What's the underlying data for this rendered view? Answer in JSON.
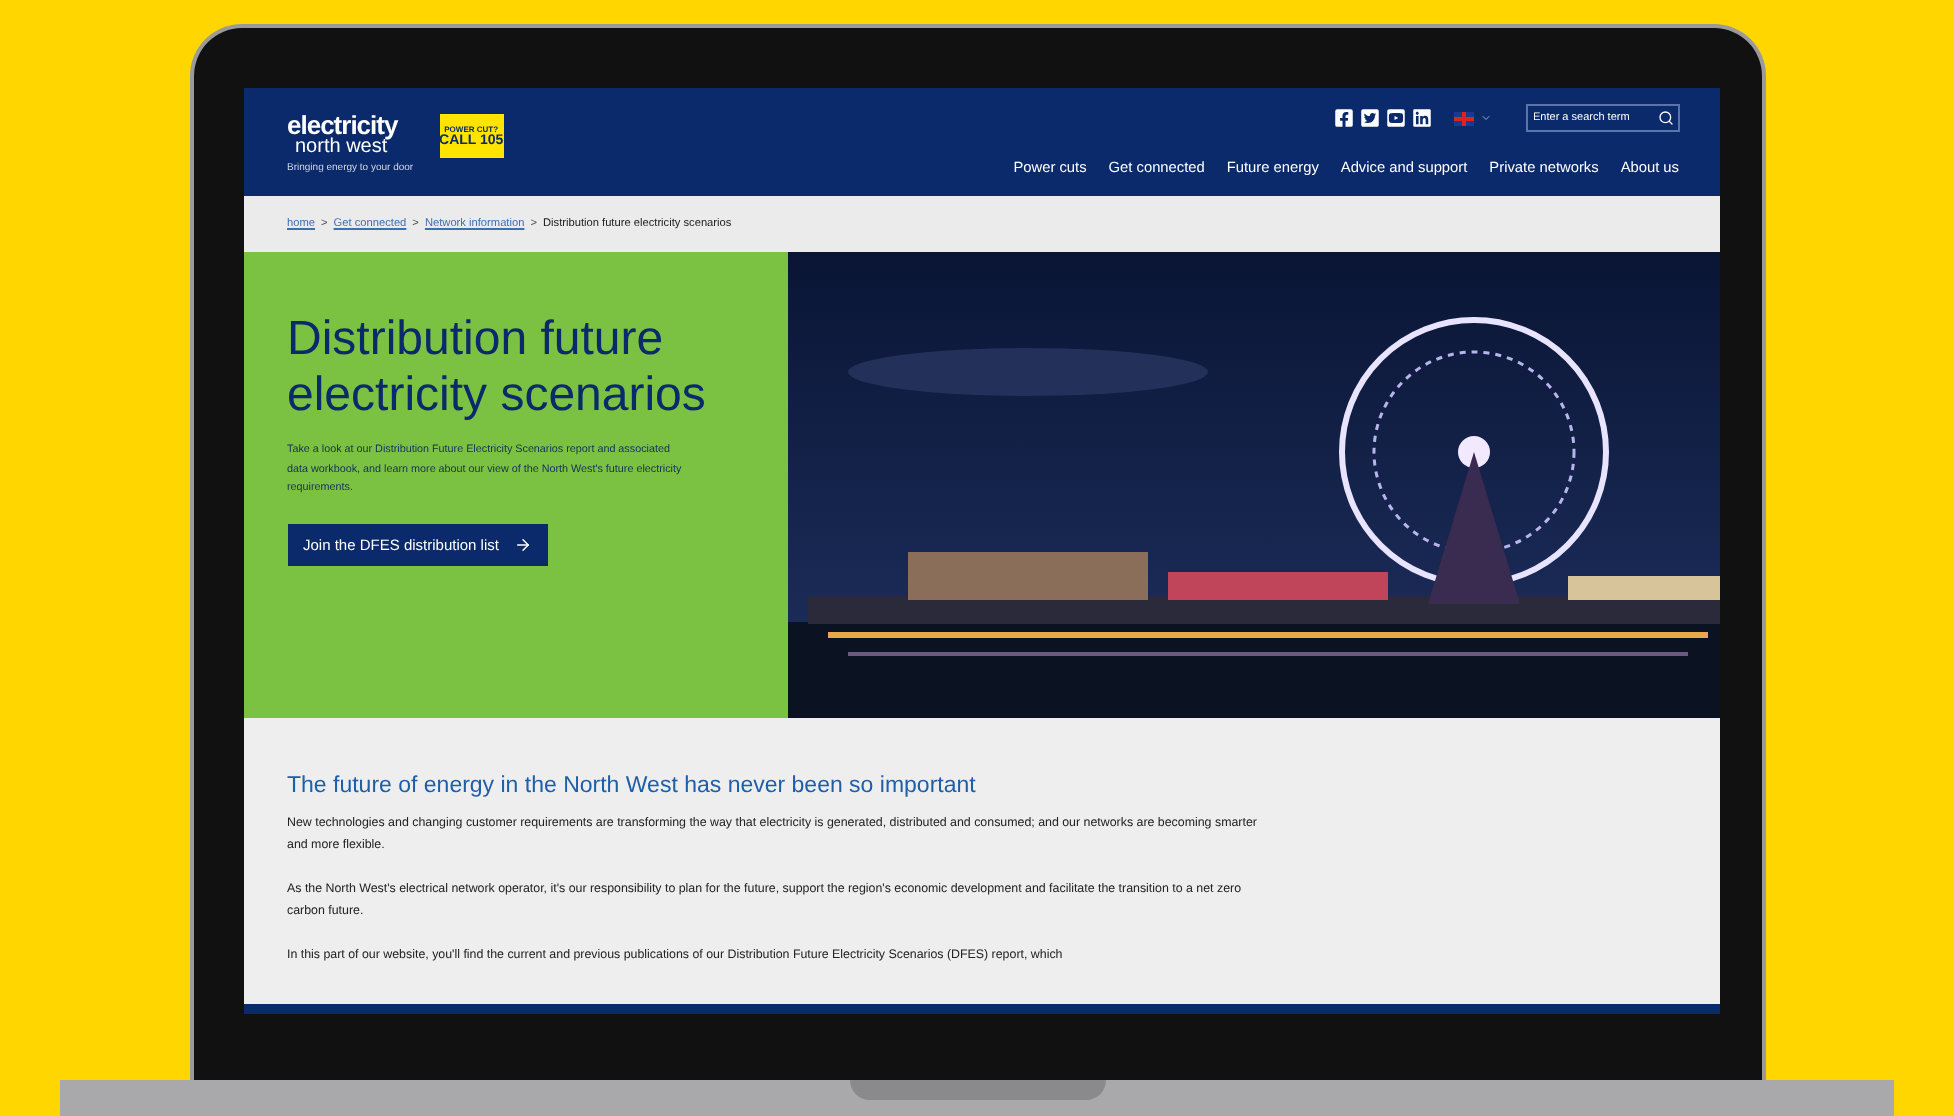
{
  "header": {
    "logo": {
      "name": "electricity",
      "region": "north west",
      "tagline": "Bringing energy to your door"
    },
    "badge": {
      "top": "POWER CUT?",
      "main": "CALL 105"
    },
    "search": {
      "placeholder": "Enter a search term"
    },
    "nav": [
      {
        "label": "Power cuts"
      },
      {
        "label": "Get connected"
      },
      {
        "label": "Future energy"
      },
      {
        "label": "Advice and support"
      },
      {
        "label": "Private networks"
      },
      {
        "label": "About us"
      }
    ]
  },
  "breadcrumb_separator": ">",
  "breadcrumb": [
    {
      "label": "home",
      "kind": "link"
    },
    {
      "label": "Get connected",
      "kind": "link"
    },
    {
      "label": "Network information",
      "kind": "link"
    },
    {
      "label": "Distribution future electricity scenarios",
      "kind": "current"
    }
  ],
  "hero": {
    "title": "Distribution future electricity scenarios",
    "text": "Take a look at our Distribution Future Electricity Scenarios report and associated data workbook, and learn more about our view of the North West's future electricity requirements.",
    "button": "Join the DFES distribution list"
  },
  "content": {
    "heading": "The future of energy in the North West has never been so important",
    "paragraphs": [
      "New technologies and changing customer requirements are transforming the way that electricity is generated, distributed and consumed; and our networks are becoming smarter and more flexible.",
      "As the North West's electrical network operator, it's our responsibility to plan for the future, support the region's economic development and facilitate the transition to a net zero carbon future.",
      "In this part of our website, you'll find the current and previous publications of our Distribution Future Electricity Scenarios (DFES) report, which"
    ]
  }
}
